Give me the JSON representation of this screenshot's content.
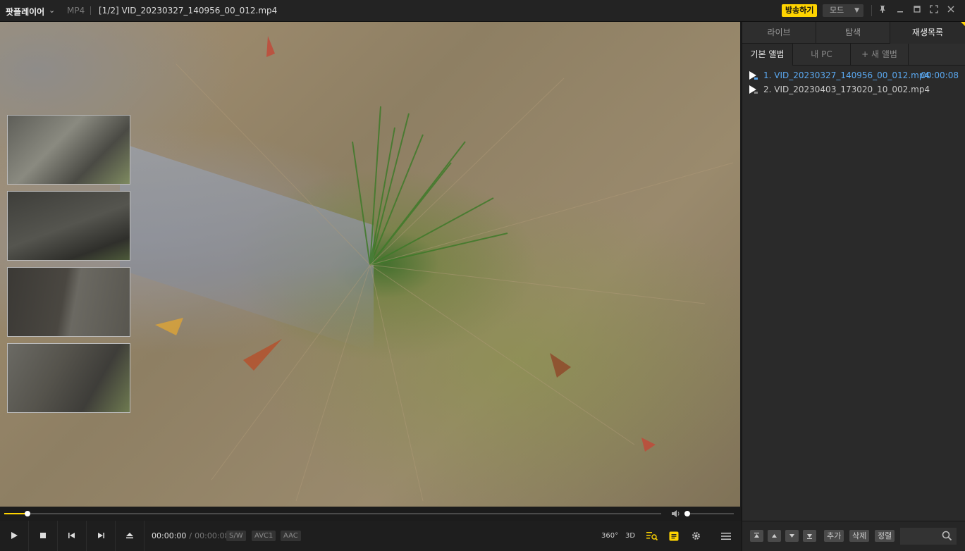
{
  "titlebar": {
    "app_name": "팟플레이어",
    "format": "MP4",
    "file_title": "[1/2] VID_20230327_140956_00_012.mp4",
    "broadcast_label": "방송하기",
    "mode_label": "모드"
  },
  "panel": {
    "tabs": [
      {
        "label": "라이브"
      },
      {
        "label": "탐색"
      },
      {
        "label": "재생목록",
        "active": true
      }
    ],
    "subtabs": [
      {
        "label": "기본 앨범",
        "active": true
      },
      {
        "label": "내 PC"
      },
      {
        "label": "+ 새 앨범"
      }
    ],
    "playlist": [
      {
        "label": "1. VID_20230327_140956_00_012.mp4",
        "duration": "00:00:08",
        "active": true
      },
      {
        "label": "2. VID_20230403_173020_10_002.mp4",
        "duration": ""
      }
    ],
    "toolbar": {
      "add_label": "추가",
      "delete_label": "삭제",
      "sort_label": "정렬"
    }
  },
  "player": {
    "current_time": "00:00:00",
    "total_time": "00:00:08",
    "progress": 0.035,
    "volume": 0.0,
    "codecs": [
      "S/W",
      "AVC1",
      "AAC"
    ],
    "icons": [
      "play-icon",
      "stop-icon",
      "previous-icon",
      "next-icon",
      "eject-icon",
      "360-icon",
      "3d-icon",
      "playlist-search-icon",
      "subtitle-icon",
      "settings-icon",
      "menu-icon"
    ],
    "labels": {
      "vr": "360°",
      "threed": "3D"
    }
  },
  "colors": {
    "accent": "#ffd400",
    "active_item": "#5aa8f0"
  }
}
